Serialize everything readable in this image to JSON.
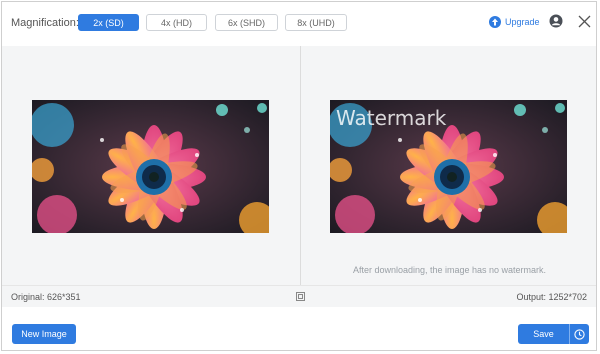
{
  "toolbar": {
    "magnification_label": "Magnification:",
    "options": [
      "2x (SD)",
      "4x (HD)",
      "6x (SHD)",
      "8x (UHD)"
    ],
    "selected": "2x (SD)",
    "upgrade_label": "Upgrade",
    "icons": {
      "upgrade": "upgrade-arrow-icon",
      "user": "user-icon",
      "close": "close-icon"
    }
  },
  "preview": {
    "watermark_text": "Watermark",
    "note": "After downloading, the image has no watermark."
  },
  "status": {
    "original": "Original: 626*351",
    "output": "Output: 1252*702",
    "compare_icon": "compare-icon"
  },
  "footer": {
    "new_image_label": "New Image",
    "save_label": "Save",
    "history_icon": "clock-icon"
  },
  "colors": {
    "accent": "#2f7be0",
    "panel": "#f4f5f6"
  }
}
